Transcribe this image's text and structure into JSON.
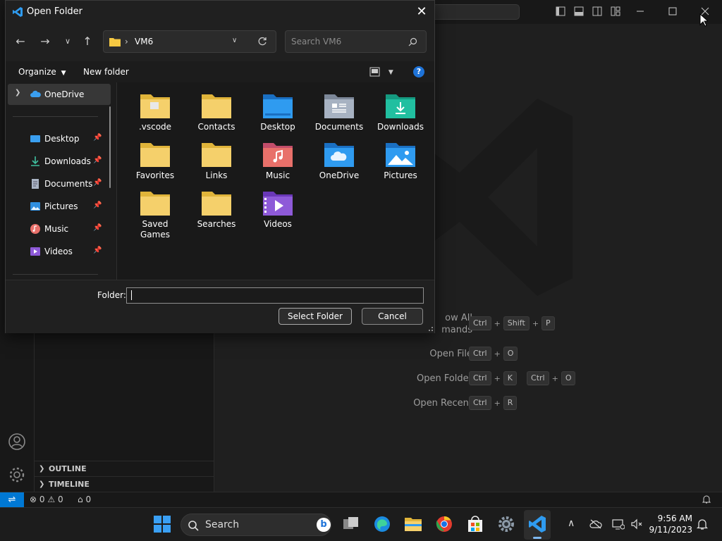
{
  "vscode": {
    "sidebar_sections": [
      "OUTLINE",
      "TIMELINE"
    ],
    "shortcuts": [
      {
        "label": "Show All Commands",
        "label_visible": "ow All\nmands",
        "keys": [
          [
            "Ctrl",
            "Shift",
            "P"
          ]
        ]
      },
      {
        "label": "Open File",
        "keys": [
          [
            "Ctrl",
            "O"
          ]
        ]
      },
      {
        "label": "Open Folder",
        "keys": [
          [
            "Ctrl",
            "K"
          ],
          [
            "Ctrl",
            "O"
          ]
        ]
      },
      {
        "label": "Open Recent",
        "keys": [
          [
            "Ctrl",
            "R"
          ]
        ]
      }
    ],
    "status": {
      "errors": "0",
      "warnings": "0",
      "ports": "0"
    }
  },
  "dialog": {
    "title": "Open Folder",
    "address": {
      "folder": "VM6"
    },
    "search_placeholder": "Search VM6",
    "toolbar": {
      "organize": "Organize",
      "new_folder": "New folder"
    },
    "nav": {
      "root": "OneDrive",
      "pinned": [
        "Desktop",
        "Downloads",
        "Documents",
        "Pictures",
        "Music",
        "Videos"
      ]
    },
    "folders": [
      {
        "name": ".vscode",
        "icon": "vscode-folder-icon"
      },
      {
        "name": "Contacts",
        "icon": "folder-icon"
      },
      {
        "name": "Desktop",
        "icon": "desktop-folder-icon"
      },
      {
        "name": "Documents",
        "icon": "documents-folder-icon"
      },
      {
        "name": "Downloads",
        "icon": "downloads-folder-icon"
      },
      {
        "name": "Favorites",
        "icon": "folder-icon"
      },
      {
        "name": "Links",
        "icon": "folder-icon"
      },
      {
        "name": "Music",
        "icon": "music-folder-icon"
      },
      {
        "name": "OneDrive",
        "icon": "onedrive-folder-icon"
      },
      {
        "name": "Pictures",
        "icon": "pictures-folder-icon"
      },
      {
        "name": "Saved Games",
        "icon": "folder-icon"
      },
      {
        "name": "Searches",
        "icon": "folder-icon"
      },
      {
        "name": "Videos",
        "icon": "videos-folder-icon"
      }
    ],
    "folder_label": "Folder:",
    "folder_value": "",
    "select_button": "Select Folder",
    "cancel_button": "Cancel"
  },
  "taskbar": {
    "search_label": "Search",
    "time": "9:56 AM",
    "date": "9/11/2023"
  },
  "colors": {
    "accent": "#0078d4",
    "folder_yellow": "#f5c842"
  }
}
